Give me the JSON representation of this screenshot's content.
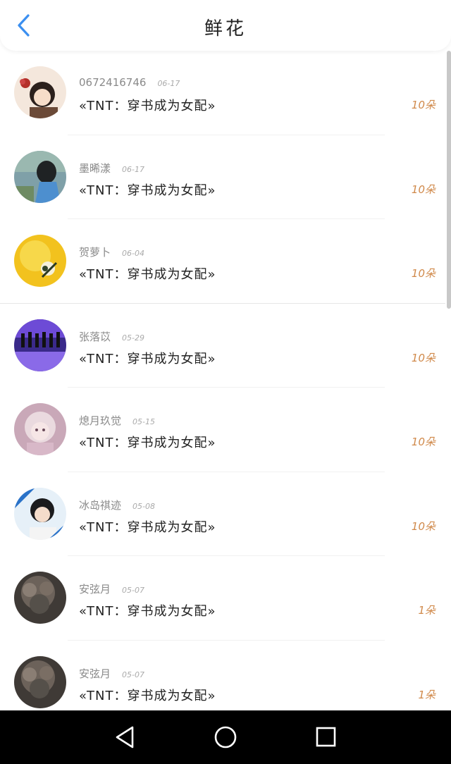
{
  "header": {
    "title": "鲜花"
  },
  "items": [
    {
      "name": "0672416746",
      "date": "06-17",
      "book": "«TNT：穿书成为女配»",
      "amount": "10朵"
    },
    {
      "name": "墨晞漾",
      "date": "06-17",
      "book": "«TNT：穿书成为女配»",
      "amount": "10朵"
    },
    {
      "name": "贺萝卜",
      "date": "06-04",
      "book": "«TNT：穿书成为女配»",
      "amount": "10朵"
    },
    {
      "name": "张落苡",
      "date": "05-29",
      "book": "«TNT：穿书成为女配»",
      "amount": "10朵"
    },
    {
      "name": "熄月玖觉",
      "date": "05-15",
      "book": "«TNT：穿书成为女配»",
      "amount": "10朵"
    },
    {
      "name": "冰岛祺迹",
      "date": "05-08",
      "book": "«TNT：穿书成为女配»",
      "amount": "10朵"
    },
    {
      "name": "安弦月",
      "date": "05-07",
      "book": "«TNT：穿书成为女配»",
      "amount": "1朵"
    },
    {
      "name": "安弦月",
      "date": "05-07",
      "book": "«TNT：穿书成为女配»",
      "amount": "1朵"
    }
  ],
  "colors": {
    "accent_blue": "#3b8ff0",
    "amount": "#d0894a"
  },
  "icons": {
    "back": "chevron-left-icon",
    "nav_back": "triangle-back-icon",
    "nav_home": "circle-home-icon",
    "nav_recent": "square-recent-icon"
  }
}
